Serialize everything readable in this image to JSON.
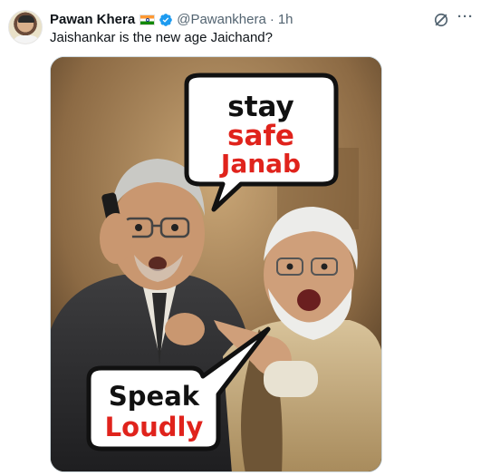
{
  "tweet": {
    "author": {
      "display_name": "Pawan Khera",
      "handle": "@Pawankhera",
      "avatar_icon": "avatar-photo",
      "flag_icon": "india-flag-icon",
      "verified_icon": "verified-badge-icon"
    },
    "timestamp": "1h",
    "separator": "·",
    "text": "Jaishankar is the new age Jaichand?",
    "actions": {
      "grok_icon": "grok-icon",
      "more_icon": "more-options-icon",
      "more_label": "···"
    },
    "media": {
      "bubble_top": {
        "line1": "stay",
        "line2": "safe",
        "line3": "Janab"
      },
      "bubble_bottom": {
        "line1": "Speak",
        "line2": "Loudly"
      }
    }
  },
  "colors": {
    "verified_blue": "#1d9bf0",
    "bubble_red": "#e0231c",
    "bubble_black": "#111111",
    "secondary_text": "#536471"
  }
}
